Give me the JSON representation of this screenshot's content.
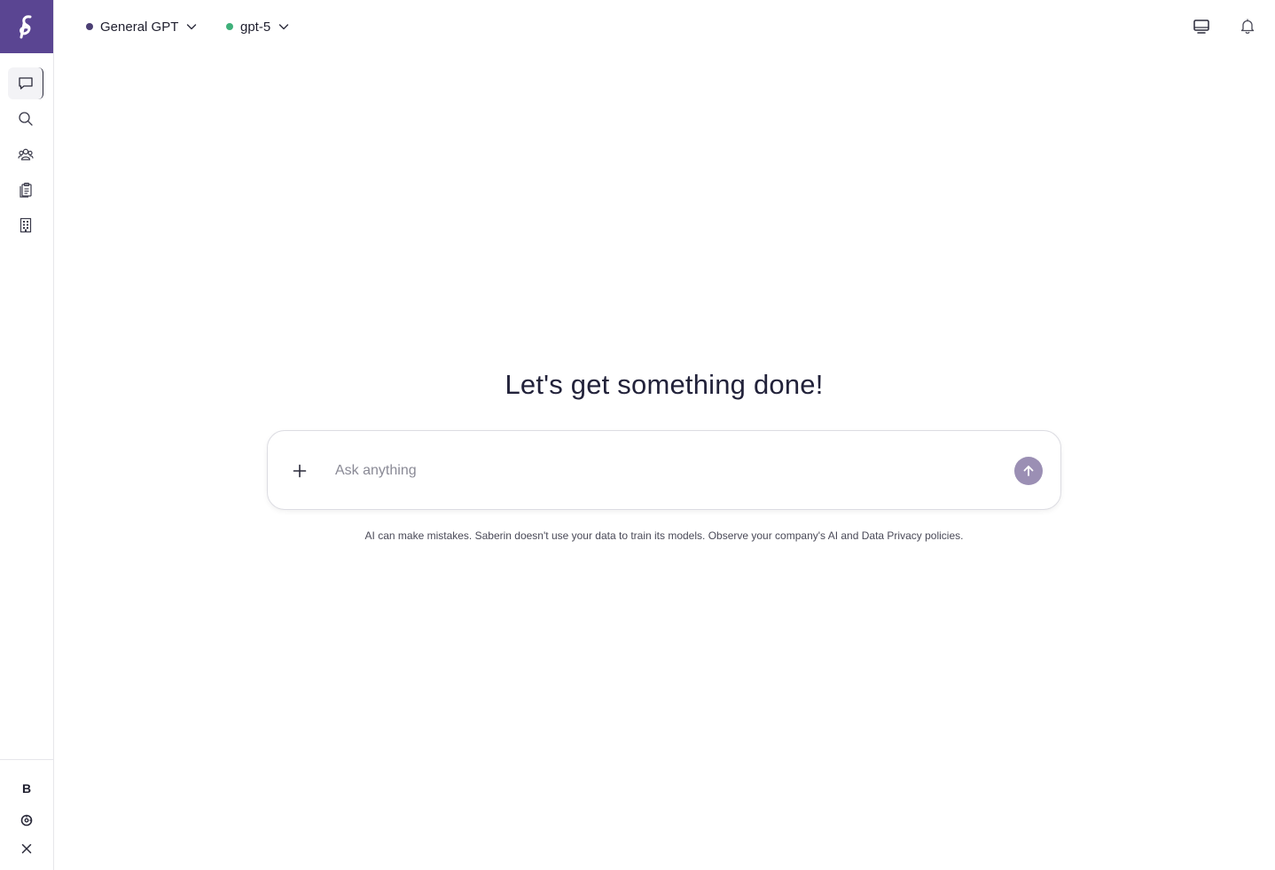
{
  "header": {
    "assistant_selector": {
      "label": "General GPT",
      "dot_color": "#4b3f74"
    },
    "model_selector": {
      "label": "gpt-5",
      "dot_color": "#3fb07a"
    }
  },
  "sidebar": {
    "items": [
      {
        "icon": "chat-icon",
        "active": true
      },
      {
        "icon": "search-icon",
        "active": false
      },
      {
        "icon": "users-icon",
        "active": false
      },
      {
        "icon": "clipboard-icon",
        "active": false
      },
      {
        "icon": "building-icon",
        "active": false
      }
    ],
    "bottom": {
      "avatar_letter": "B",
      "settings_icon": "gear-icon",
      "close_icon": "close-icon"
    }
  },
  "main": {
    "headline": "Let's get something done!",
    "composer": {
      "placeholder": "Ask anything"
    },
    "disclaimer": "AI can make mistakes. Saberin doesn't use your data to train its models. Observe your company's AI and Data Privacy policies."
  },
  "colors": {
    "brand": "#5a4592",
    "send_button": "#9b8fb4"
  }
}
